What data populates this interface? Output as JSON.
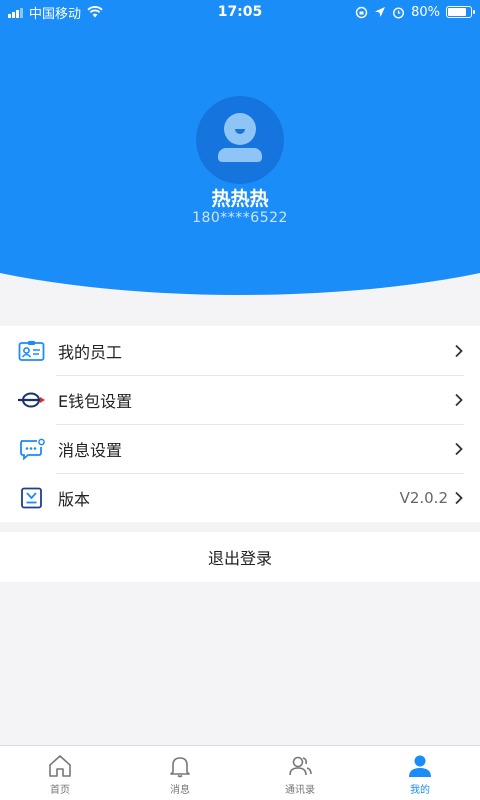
{
  "status_bar": {
    "carrier": "中国移动",
    "time": "17:05",
    "battery": "80%",
    "battery_level": 0.8
  },
  "profile": {
    "name": "热热热",
    "phone": "180****6522"
  },
  "menu": {
    "items": [
      {
        "label": "我的员工",
        "icon": "employee-card-icon",
        "value": ""
      },
      {
        "label": "E钱包设置",
        "icon": "e-wallet-logo-icon",
        "value": ""
      },
      {
        "label": "消息设置",
        "icon": "message-settings-icon",
        "value": ""
      },
      {
        "label": "版本",
        "icon": "version-download-icon",
        "value": "V2.0.2"
      }
    ]
  },
  "logout_label": "退出登录",
  "tabbar": {
    "tabs": [
      {
        "label": "首页",
        "icon": "home-icon"
      },
      {
        "label": "消息",
        "icon": "bell-icon"
      },
      {
        "label": "通讯录",
        "icon": "contacts-icon"
      },
      {
        "label": "我的",
        "icon": "profile-icon",
        "active": true
      }
    ]
  },
  "colors": {
    "primary": "#1a8df8",
    "avatar_bg": "#1574dd",
    "text": "#222222",
    "secondary_text": "#666666"
  }
}
